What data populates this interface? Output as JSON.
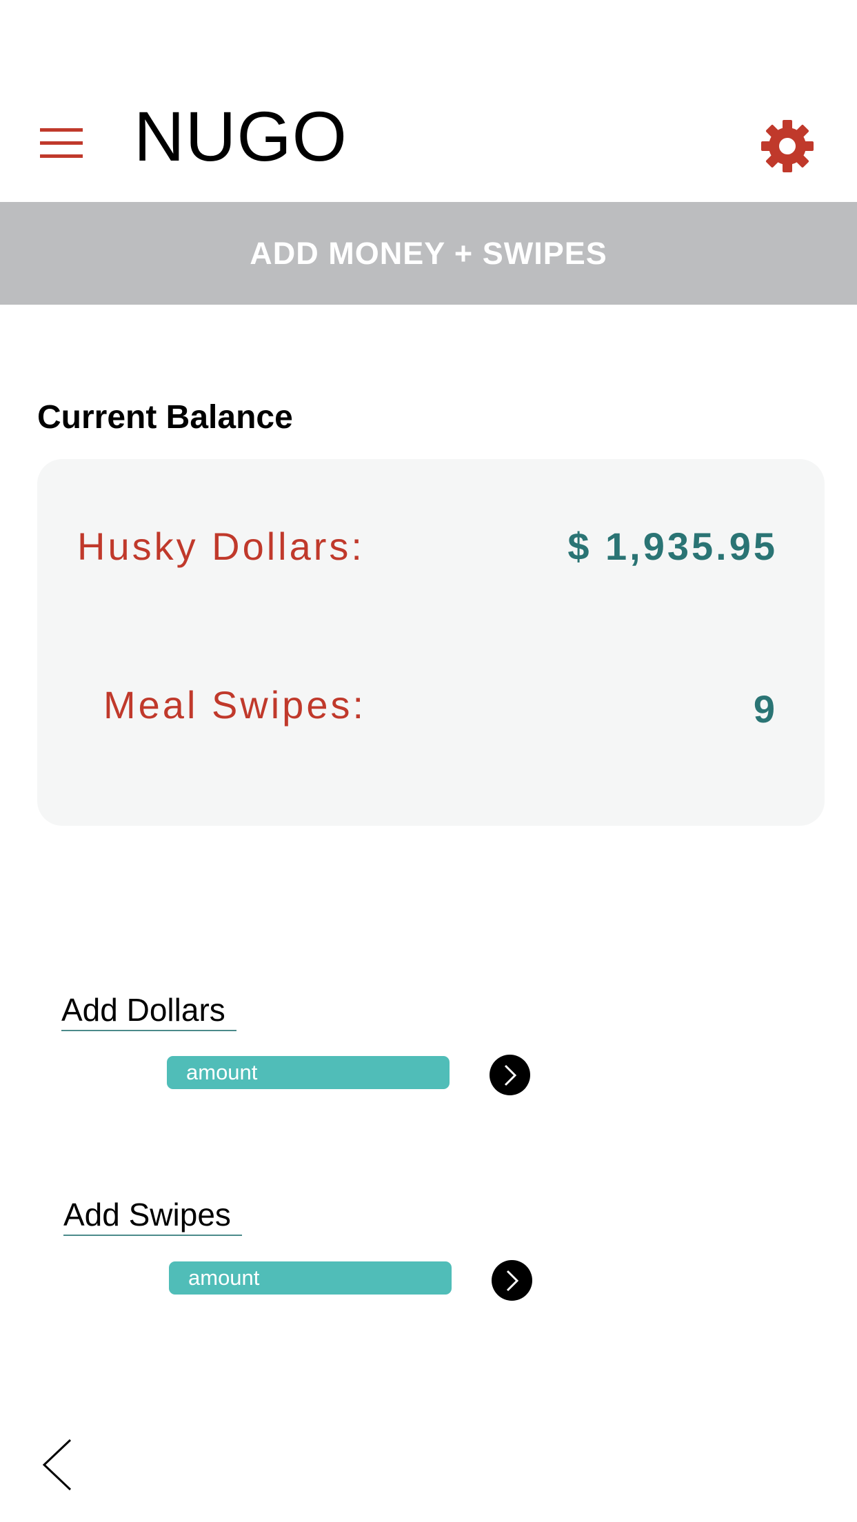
{
  "header": {
    "title": "NUGO",
    "menu_icon": "hamburger-menu-icon",
    "settings_icon": "gear-icon"
  },
  "banner": {
    "text": "ADD MONEY + SWIPES"
  },
  "balance": {
    "heading": "Current Balance",
    "husky_dollars_label": "Husky Dollars:",
    "husky_dollars_value": "$ 1,935.95",
    "meal_swipes_label": "Meal Swipes:",
    "meal_swipes_value": "9"
  },
  "add_dollars": {
    "label": "Add Dollars",
    "placeholder": "amount",
    "submit_icon": "chevron-right-icon"
  },
  "add_swipes": {
    "label": "Add Swipes",
    "placeholder": "amount",
    "submit_icon": "chevron-right-icon"
  },
  "footer": {
    "back_icon": "chevron-left-icon"
  },
  "colors": {
    "accent_red": "#c0392b",
    "value_teal": "#2a7474",
    "input_teal": "#50bdb8",
    "banner_gray": "#bcbdbf",
    "card_bg": "#f5f6f6"
  }
}
